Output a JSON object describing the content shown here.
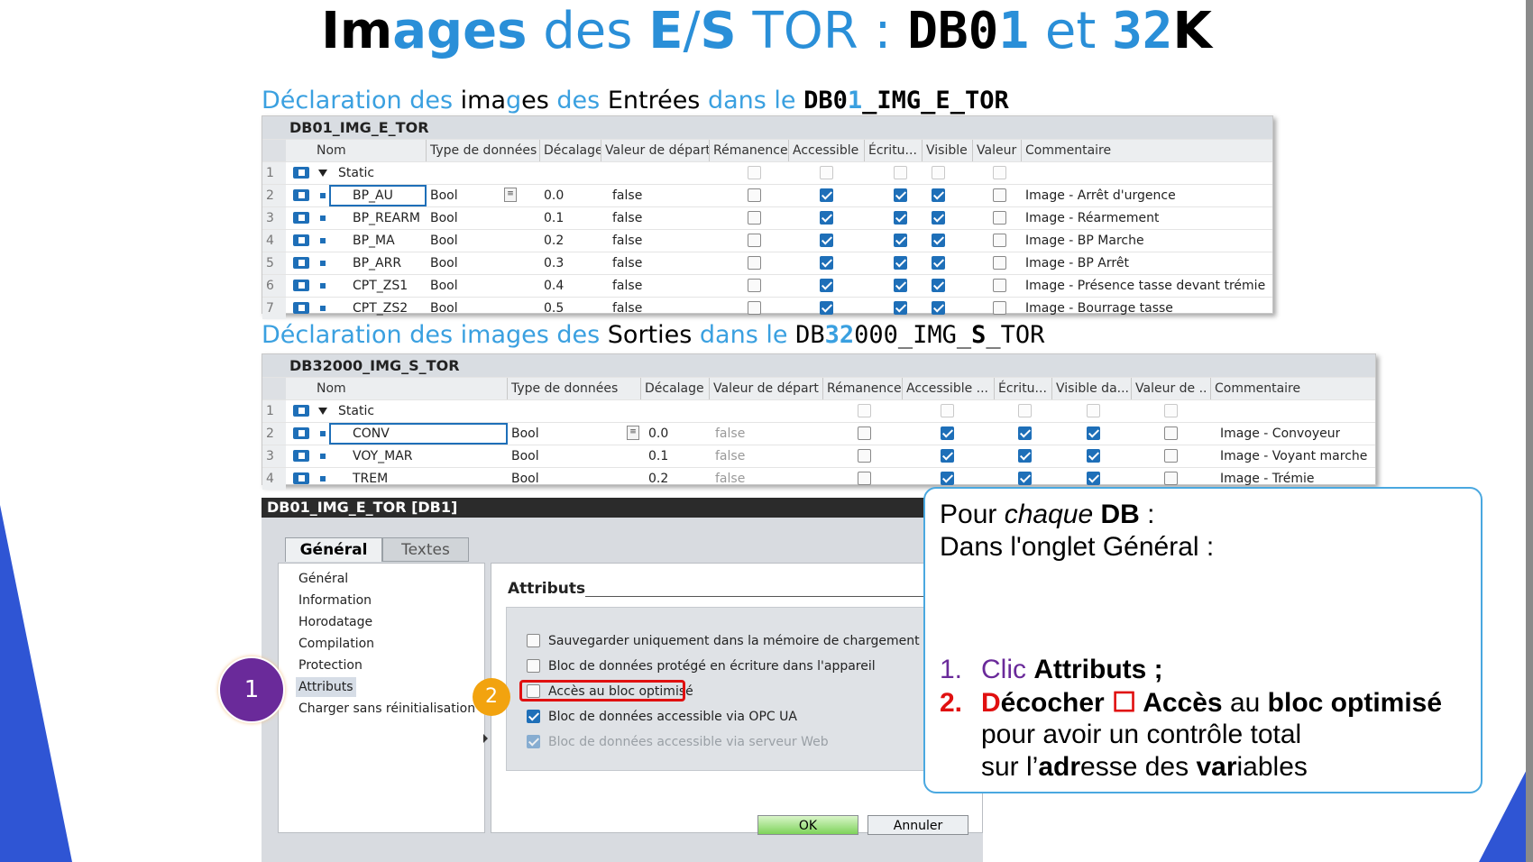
{
  "title": {
    "p1": "Im",
    "p2": "ag",
    "p3": "es",
    "p4": " des ",
    "p5": "E",
    "p6": "/",
    "p7": "S",
    "p8": " TOR : ",
    "p9": "DB0",
    "p10": "1",
    "p11": " et ",
    "p12": "32",
    "p13": "K"
  },
  "section1": {
    "a": "Déclaration des ",
    "b": "ima",
    "c": "g",
    "d": "es ",
    "e": "des ",
    "f": "Entrées ",
    "g": "dans le ",
    "h": "DB0",
    "i": "1",
    "j": "_IMG_E_TOR"
  },
  "section2": {
    "a": "Déclaration des images des ",
    "b": "Sorties ",
    "c": "dans le ",
    "d": "DB",
    "e": "32",
    "f": "000_IMG_",
    "g": "S",
    "h": "_TOR"
  },
  "table1": {
    "caption": "DB01_IMG_E_TOR",
    "headers": [
      "Nom",
      "Type de données",
      "Décalage",
      "Valeur de départ",
      "Rémanence",
      "Accessible",
      "Écritu...",
      "Visible",
      "Valeur",
      "Commentaire"
    ],
    "static_label": "Static",
    "rows": [
      {
        "n": "2",
        "name": "BP_AU",
        "type": "Bool",
        "offset": "0.0",
        "start": "false",
        "comment": "Image - Arrêt d'urgence"
      },
      {
        "n": "3",
        "name": "BP_REARM",
        "type": "Bool",
        "offset": "0.1",
        "start": "false",
        "comment": "Image - Réarmement"
      },
      {
        "n": "4",
        "name": "BP_MA",
        "type": "Bool",
        "offset": "0.2",
        "start": "false",
        "comment": "Image - BP Marche"
      },
      {
        "n": "5",
        "name": "BP_ARR",
        "type": "Bool",
        "offset": "0.3",
        "start": "false",
        "comment": "Image - BP Arrêt"
      },
      {
        "n": "6",
        "name": "CPT_ZS1",
        "type": "Bool",
        "offset": "0.4",
        "start": "false",
        "comment": "Image - Présence tasse devant trémie"
      },
      {
        "n": "7",
        "name": "CPT_ZS2",
        "type": "Bool",
        "offset": "0.5",
        "start": "false",
        "comment": "Image - Bourrage tasse"
      }
    ]
  },
  "table2": {
    "caption": "DB32000_IMG_S_TOR",
    "headers": [
      "Nom",
      "Type de données",
      "Décalage",
      "Valeur de départ",
      "Rémanence",
      "Accessible ...",
      "Écritu...",
      "Visible da...",
      "Valeur de ..",
      "Commentaire"
    ],
    "static_label": "Static",
    "rows": [
      {
        "n": "2",
        "name": "CONV",
        "type": "Bool",
        "offset": "0.0",
        "start": "false",
        "comment": "Image - Convoyeur"
      },
      {
        "n": "3",
        "name": "VOY_MAR",
        "type": "Bool",
        "offset": "0.1",
        "start": "false",
        "comment": "Image - Voyant marche"
      },
      {
        "n": "4",
        "name": "TREM",
        "type": "Bool",
        "offset": "0.2",
        "start": "false",
        "comment": "Image - Trémie"
      }
    ]
  },
  "dialog": {
    "title": "DB01_IMG_E_TOR [DB1]",
    "tabs": [
      "Général",
      "Textes"
    ],
    "nav": [
      "Général",
      "Information",
      "Horodatage",
      "Compilation",
      "Protection",
      "Attributs",
      "Charger sans réinitialisation"
    ],
    "section_title": "Attributs",
    "options": [
      {
        "label": "Sauvegarder uniquement dans la mémoire de chargement",
        "checked": false
      },
      {
        "label": "Bloc de données protégé en écriture dans l'appareil",
        "checked": false
      },
      {
        "label": "Accès au bloc optimisé",
        "checked": false
      },
      {
        "label": "Bloc de données accessible via OPC UA",
        "checked": true
      },
      {
        "label": "Bloc de données accessible via serveur Web",
        "checked": true
      }
    ],
    "ok": "OK",
    "cancel": "Annuler"
  },
  "markers": {
    "one": "1",
    "two": "2"
  },
  "note": {
    "l1a": "Pour ",
    "l1b": "chaque ",
    "l1c": "DB",
    " l1d": " :",
    "l1d": " :",
    "l2": "Dans l'onglet Général :",
    "s1n": "1.",
    "s1a": "Clic ",
    "s1b": "Attributs ;",
    "s2n": "2.",
    "s2a": "D",
    "s2b": "écocher ",
    "s2c": "☐ ",
    "s2d": "Accès ",
    "s2e": "au ",
    "s2f": "bloc optimisé",
    "s3": "pour avoir un contrôle total",
    "s4a": "sur l’",
    "s4b": "adr",
    "s4c": "esse des ",
    "s4d": "var",
    "s4e": "iables"
  },
  "colors": {
    "accent": "#3aa0e0",
    "purple": "#6a2a9a",
    "orange": "#f2a30f",
    "red": "#e01010",
    "box_border": "#4aa8e0"
  }
}
